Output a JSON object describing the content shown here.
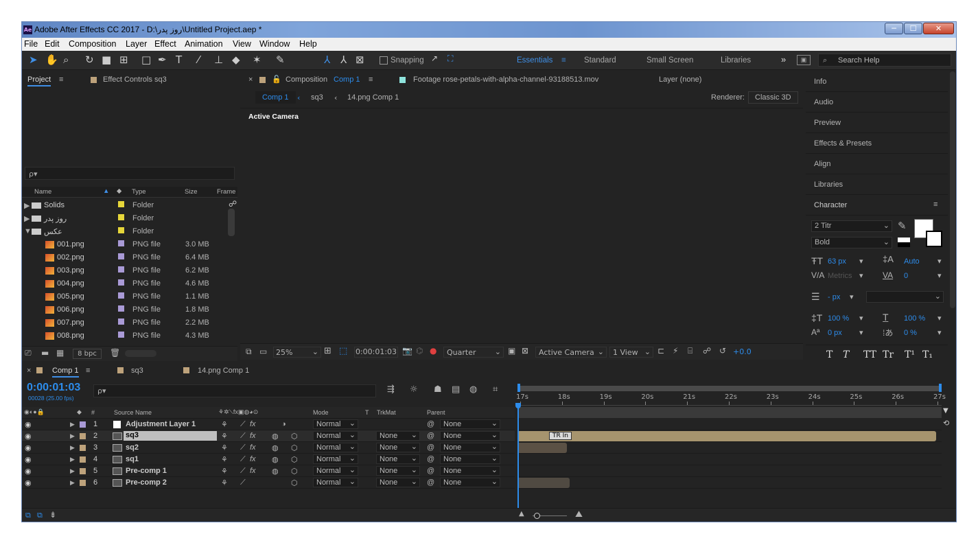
{
  "titlebar": {
    "app_badge": "Ae",
    "title": "Adobe After Effects CC 2017 - D:\\روز پدر\\Untitled Project.aep *",
    "min": "─",
    "max": "☐",
    "close": "✕"
  },
  "menu": [
    "File",
    "Edit",
    "Composition",
    "Layer",
    "Effect",
    "Animation",
    "View",
    "Window",
    "Help"
  ],
  "toolbar": {
    "snapping": "Snapping",
    "workspaces": [
      "Essentials",
      "Standard",
      "Small Screen",
      "Libraries"
    ],
    "more": "»",
    "search_placeholder": "Search Help"
  },
  "project": {
    "tab": "Project",
    "effect_controls": "Effect Controls sq3",
    "search_placeholder": "ρ▾",
    "columns": [
      "Name",
      "Type",
      "Size",
      "Frame"
    ],
    "items": [
      {
        "name": "Solids",
        "type": "Folder",
        "size": "",
        "color": "#e6d63a",
        "kind": "folder",
        "open": false
      },
      {
        "name": "روز پدر",
        "type": "Folder",
        "size": "",
        "color": "#e6d63a",
        "kind": "folder",
        "open": false
      },
      {
        "name": "عکس",
        "type": "Folder",
        "size": "",
        "color": "#e6d63a",
        "kind": "folder",
        "open": true
      },
      {
        "name": "001.png",
        "type": "PNG file",
        "size": "3.0 MB",
        "color": "#a99ad6",
        "kind": "file"
      },
      {
        "name": "002.png",
        "type": "PNG file",
        "size": "6.4 MB",
        "color": "#a99ad6",
        "kind": "file"
      },
      {
        "name": "003.png",
        "type": "PNG file",
        "size": "6.2 MB",
        "color": "#a99ad6",
        "kind": "file"
      },
      {
        "name": "004.png",
        "type": "PNG file",
        "size": "4.6 MB",
        "color": "#a99ad6",
        "kind": "file"
      },
      {
        "name": "005.png",
        "type": "PNG file",
        "size": "1.1 MB",
        "color": "#a99ad6",
        "kind": "file"
      },
      {
        "name": "006.png",
        "type": "PNG file",
        "size": "1.8 MB",
        "color": "#a99ad6",
        "kind": "file"
      },
      {
        "name": "007.png",
        "type": "PNG file",
        "size": "2.2 MB",
        "color": "#a99ad6",
        "kind": "file"
      },
      {
        "name": "008.png",
        "type": "PNG file",
        "size": "4.3 MB",
        "color": "#a99ad6",
        "kind": "file"
      }
    ],
    "bpc": "8 bpc"
  },
  "comp": {
    "tab_prefix": "Composition",
    "tab_name": "Comp 1",
    "footage": "Footage rose-petals-with-alpha-channel-93188513.mov",
    "layer": "Layer (none)",
    "breadcrumbs": [
      "Comp 1",
      "sq3",
      "14.png Comp 1"
    ],
    "renderer_label": "Renderer:",
    "renderer": "Classic 3D",
    "view_label": "Active Camera",
    "zoom": "25%",
    "timecode": "0:00:01:03",
    "resolution": "Quarter",
    "camera": "Active Camera",
    "views": "1 View",
    "exposure": "+0.0"
  },
  "right": {
    "panels": [
      "Info",
      "Audio",
      "Preview",
      "Effects & Presets",
      "Align",
      "Libraries"
    ],
    "character": "Character",
    "font": "2 Titr",
    "style": "Bold",
    "size": "63 px",
    "leading": "Auto",
    "kerning": "Metrics",
    "tracking": "0",
    "stroke": "- px",
    "vscale": "100 %",
    "hscale": "100 %",
    "baseline": "0 px",
    "tsume": "0 %",
    "styles": [
      "T",
      "T",
      "TT",
      "Tr",
      "T¹",
      "T₁"
    ]
  },
  "timeline": {
    "tabs": [
      "Comp 1",
      "sq3",
      "14.png Comp 1"
    ],
    "timecode": "0:00:01:03",
    "fps": "00028 (25.00 fps)",
    "search_placeholder": "ρ▾",
    "headers": {
      "num": "#",
      "source": "Source Name",
      "mode": "Mode",
      "t": "T",
      "trkmat": "TrkMat",
      "parent": "Parent"
    },
    "layers": [
      {
        "num": "1",
        "name": "Adjustment Layer 1",
        "mode": "Normal",
        "trkmat": "",
        "parent": "None",
        "color": "#a99ad6",
        "selected": false
      },
      {
        "num": "2",
        "name": "sq3",
        "mode": "Normal",
        "trkmat": "None",
        "parent": "None",
        "color": "#bda27b",
        "selected": true
      },
      {
        "num": "3",
        "name": "sq2",
        "mode": "Normal",
        "trkmat": "None",
        "parent": "None",
        "color": "#bda27b",
        "selected": false
      },
      {
        "num": "4",
        "name": "sq1",
        "mode": "Normal",
        "trkmat": "None",
        "parent": "None",
        "color": "#bda27b",
        "selected": false
      },
      {
        "num": "5",
        "name": "Pre-comp 1",
        "mode": "Normal",
        "trkmat": "None",
        "parent": "None",
        "color": "#bda27b",
        "selected": false
      },
      {
        "num": "6",
        "name": "Pre-comp 2",
        "mode": "Normal",
        "trkmat": "None",
        "parent": "None",
        "color": "#bda27b",
        "selected": false
      }
    ],
    "ruler": [
      "17s",
      "18s",
      "19s",
      "20s",
      "21s",
      "22s",
      "23s",
      "24s",
      "25s",
      "26s",
      "27s"
    ],
    "marker": "TR In"
  }
}
